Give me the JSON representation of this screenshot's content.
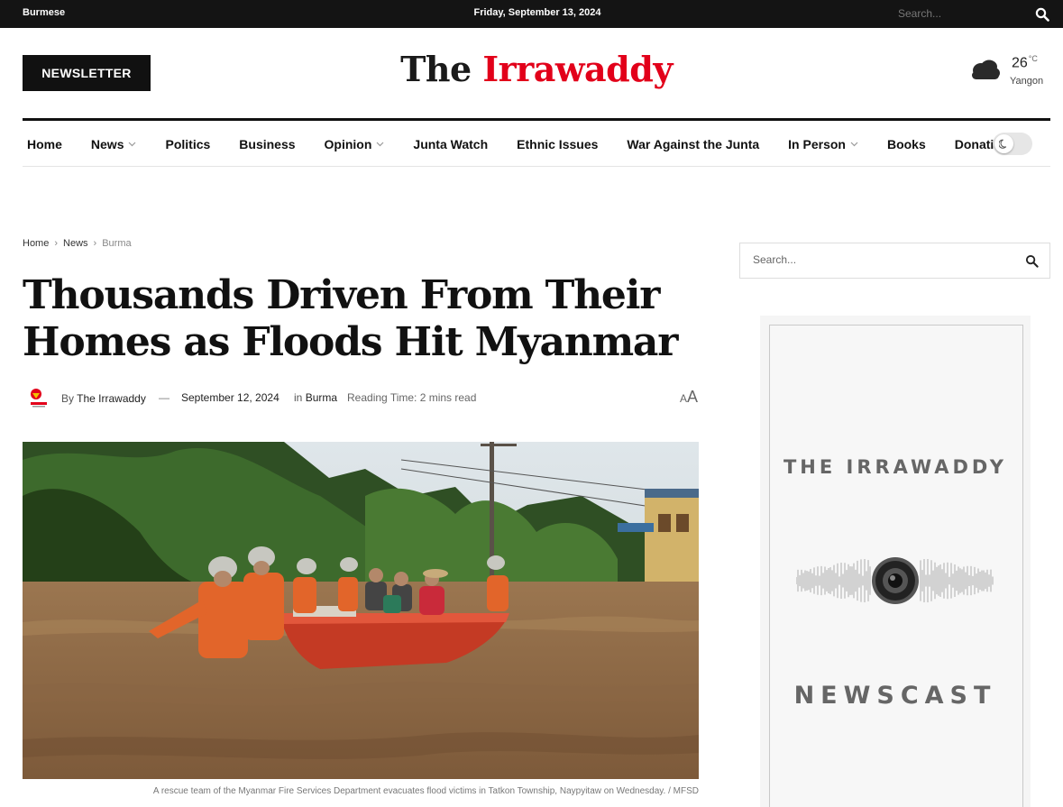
{
  "topbar": {
    "language_link": "Burmese",
    "date": "Friday, September 13, 2024",
    "search_placeholder": "Search..."
  },
  "header": {
    "newsletter_label": "NEWSLETTER",
    "logo_part1": "The",
    "logo_part2": "Irrawaddy",
    "weather": {
      "temperature": "26",
      "unit": "°C",
      "city": "Yangon",
      "icon": "cloudy-icon"
    }
  },
  "nav": {
    "items": [
      {
        "label": "Home",
        "dropdown": false
      },
      {
        "label": "News",
        "dropdown": true
      },
      {
        "label": "Politics",
        "dropdown": false
      },
      {
        "label": "Business",
        "dropdown": false
      },
      {
        "label": "Opinion",
        "dropdown": true
      },
      {
        "label": "Junta Watch",
        "dropdown": false
      },
      {
        "label": "Ethnic Issues",
        "dropdown": false
      },
      {
        "label": "War Against the Junta",
        "dropdown": false
      },
      {
        "label": "In Person",
        "dropdown": true
      },
      {
        "label": "Books",
        "dropdown": false
      },
      {
        "label": "Donation",
        "dropdown": false
      }
    ],
    "dark_mode_toggle": false
  },
  "breadcrumb": [
    "Home",
    "News",
    "Burma"
  ],
  "article": {
    "title": "Thousands Driven From Their Homes as Floods Hit Myanmar",
    "meta": {
      "by_prefix": "By",
      "author": "The Irrawaddy",
      "separator": "—",
      "date": "September 12, 2024",
      "in_prefix": "in",
      "category": "Burma",
      "reading_time": "Reading Time: 2 mins read",
      "font_small": "A",
      "font_large": "A"
    },
    "image_caption": "A rescue team of the Myanmar Fire Services Department evacuates flood victims in Tatkon Township, Naypyitaw on Wednesday. / MFSD"
  },
  "sidebar": {
    "search_placeholder": "Search...",
    "ad": {
      "line1": "THE IRRAWADDY",
      "line2": "NEWSCAST"
    }
  },
  "colors": {
    "accent": "#e2001a",
    "topbar": "#141414",
    "text": "#111111"
  }
}
